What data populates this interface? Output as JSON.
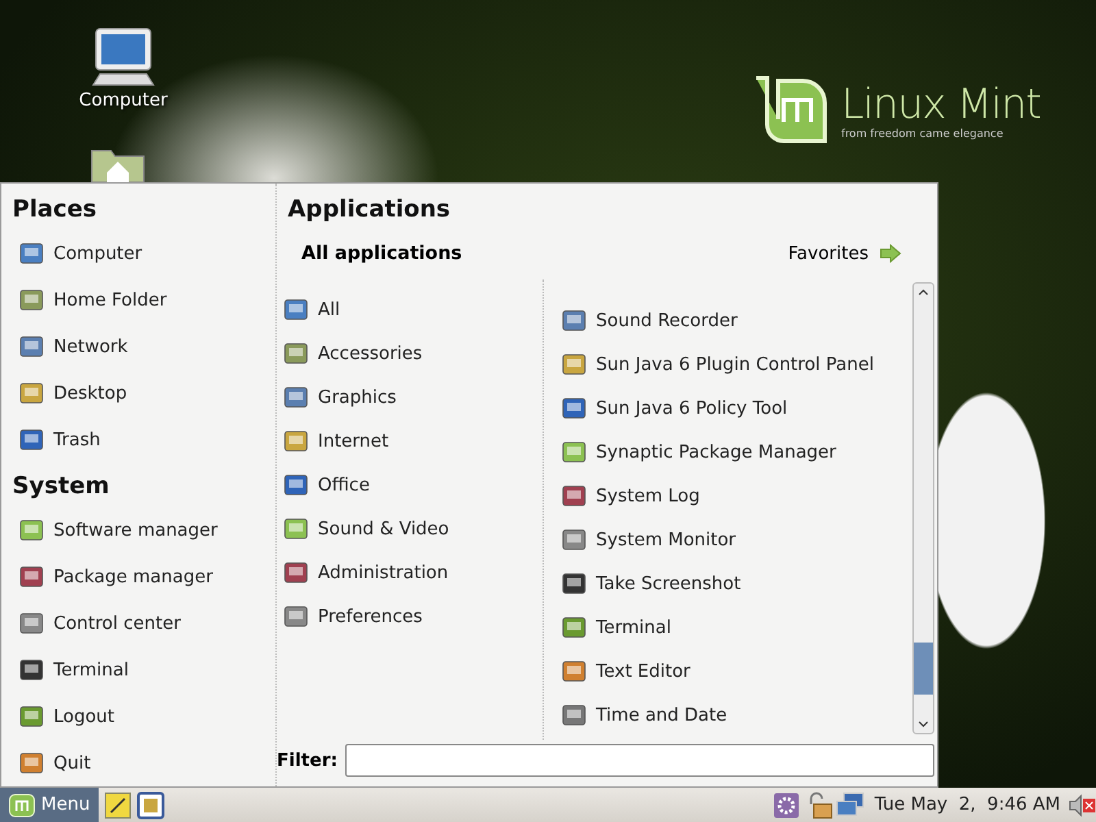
{
  "desktop": {
    "icons": [
      {
        "label": "Computer"
      }
    ],
    "logo": {
      "name": "Linux Mint",
      "tagline": "from freedom came elegance"
    }
  },
  "menu": {
    "places": {
      "title": "Places",
      "items": [
        {
          "label": "Computer"
        },
        {
          "label": "Home Folder"
        },
        {
          "label": "Network"
        },
        {
          "label": "Desktop"
        },
        {
          "label": "Trash"
        }
      ]
    },
    "system": {
      "title": "System",
      "items": [
        {
          "label": "Software manager"
        },
        {
          "label": "Package manager"
        },
        {
          "label": "Control center"
        },
        {
          "label": "Terminal"
        },
        {
          "label": "Logout"
        },
        {
          "label": "Quit"
        }
      ]
    },
    "applications": {
      "title": "Applications",
      "header": "All applications",
      "favorites": "Favorites",
      "categories": [
        {
          "label": "All"
        },
        {
          "label": "Accessories"
        },
        {
          "label": "Graphics"
        },
        {
          "label": "Internet"
        },
        {
          "label": "Office"
        },
        {
          "label": "Sound & Video"
        },
        {
          "label": "Administration"
        },
        {
          "label": "Preferences"
        }
      ],
      "apps": [
        {
          "label": "Sound Recorder"
        },
        {
          "label": "Sun Java 6 Plugin Control Panel"
        },
        {
          "label": "Sun Java 6 Policy Tool"
        },
        {
          "label": "Synaptic Package Manager"
        },
        {
          "label": "System Log"
        },
        {
          "label": "System Monitor"
        },
        {
          "label": "Take Screenshot"
        },
        {
          "label": "Terminal"
        },
        {
          "label": "Text Editor"
        },
        {
          "label": "Time and Date"
        }
      ],
      "filter": {
        "label": "Filter:"
      }
    }
  },
  "taskbar": {
    "menu_button": "Menu",
    "clock": "Tue May  2,  9:46 AM"
  }
}
